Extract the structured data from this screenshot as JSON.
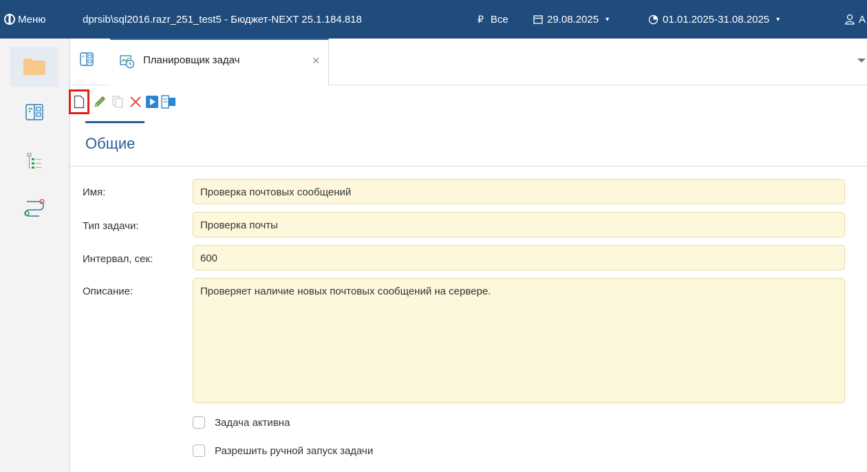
{
  "topbar": {
    "menu_label": "Меню",
    "title": "dprsib\\sql2016.razr_251_test5 - Бюджет-NEXT 25.1.184.818",
    "currency_symbol": "₽",
    "currency_label": "Все",
    "date": "29.08.2025",
    "period": "01.01.2025-31.08.2025",
    "user_initial": "А"
  },
  "tab": {
    "label": "Планировщик задач",
    "close": "×"
  },
  "section": {
    "title": "Общие"
  },
  "form": {
    "name_label": "Имя:",
    "name_value": "Проверка почтовых сообщений",
    "type_label": "Тип задачи:",
    "type_value": "Проверка почты",
    "interval_label": "Интервал, сек:",
    "interval_value": "600",
    "description_label": "Описание:",
    "description_value": "Проверяет наличие новых почтовых сообщений на сервере.",
    "active_label": "Задача активна",
    "active_checked": false,
    "manual_label": "Разрешить ручной запуск задачи",
    "manual_checked": false
  },
  "toolbar": {
    "buttons": [
      "new-document-icon",
      "edit-pencil-icon",
      "copy-icon",
      "delete-icon",
      "run-icon",
      "split-view-icon"
    ],
    "selected": "new-document-icon"
  },
  "colors": {
    "topbar": "#1f4b7d",
    "accent": "#2a5d94",
    "field_bg": "#fdf8dc",
    "highlight": "#e0201c"
  }
}
